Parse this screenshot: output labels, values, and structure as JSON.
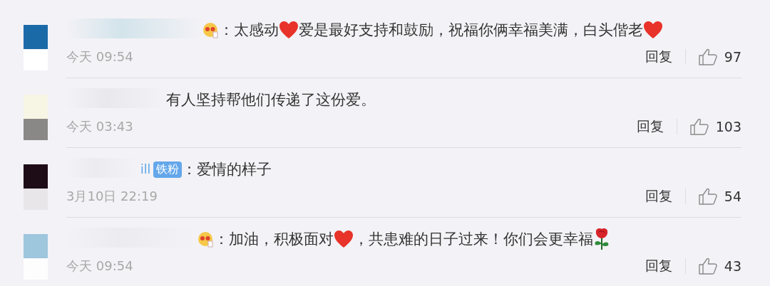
{
  "comments": [
    {
      "content": [
        {
          "kind": "emoji"
        },
        {
          "kind": "text",
          "text": "：太感动"
        },
        {
          "kind": "heart"
        },
        {
          "kind": "text",
          "text": "爱是最好支持和鼓励，祝福你俩幸福美满，白头偕老"
        },
        {
          "kind": "heart"
        }
      ],
      "time": "今天 09:54",
      "reply": "回复",
      "likes": "97"
    },
    {
      "content": [
        {
          "kind": "text",
          "text": "有人坚持帮他们传递了这份爱。"
        }
      ],
      "time": "今天 03:43",
      "reply": "回复",
      "likes": "103"
    },
    {
      "username": "ill",
      "badge": "铁粉",
      "content": [
        {
          "kind": "text",
          "text": "：爱情的样子"
        }
      ],
      "time": "3月10日 22:19",
      "reply": "回复",
      "likes": "54"
    },
    {
      "content": [
        {
          "kind": "emoji"
        },
        {
          "kind": "text",
          "text": "：加油，积极面对"
        },
        {
          "kind": "heart"
        },
        {
          "kind": "text",
          "text": "，共患难的日子过来！你们会更幸福"
        },
        {
          "kind": "rose"
        }
      ],
      "time": "今天 09:54",
      "reply": "回复",
      "likes": "43"
    }
  ]
}
